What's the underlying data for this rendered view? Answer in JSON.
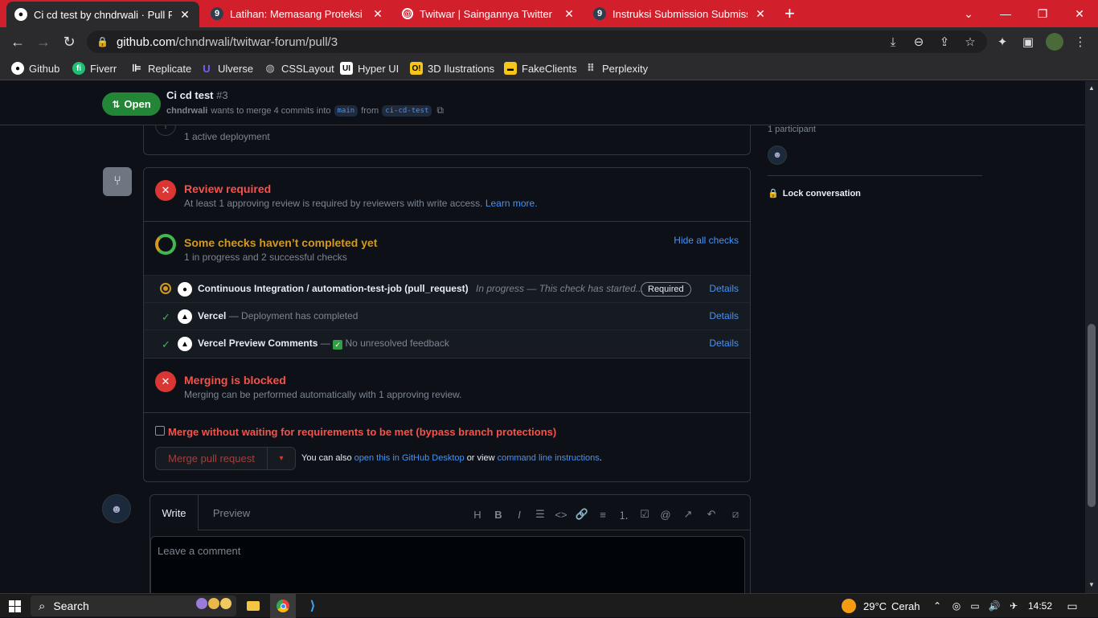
{
  "browser": {
    "tabs": [
      {
        "title": "Ci cd test by chndrwali · Pull Requ",
        "active": true
      },
      {
        "title": "Latihan: Memasang Proteksi pada",
        "active": false
      },
      {
        "title": "Twitwar | Saingannya Twitter",
        "active": false
      },
      {
        "title": "Instruksi Submission Submission",
        "active": false
      }
    ],
    "new_tab_label": "+",
    "url_host": "github.com",
    "url_path": "/chndrwali/twitwar-forum/pull/3",
    "bookmarks": [
      {
        "label": "Github",
        "icon": "github-icon",
        "color": "#ffffff"
      },
      {
        "label": "Fiverr",
        "icon": "fiverr-icon",
        "color": "#1dbf73"
      },
      {
        "label": "Replicate",
        "icon": "replicate-icon",
        "color": "#ffffff"
      },
      {
        "label": "Ulverse",
        "icon": "uiverse-icon",
        "color": "#7c5cff"
      },
      {
        "label": "CSSLayout",
        "icon": "globe-icon",
        "color": "#bbbbbb"
      },
      {
        "label": "Hyper UI",
        "icon": "hyperui-icon",
        "color": "#ffffff"
      },
      {
        "label": "3D Ilustrations",
        "icon": "3d-icon",
        "color": "#f5c518"
      },
      {
        "label": "FakeClients",
        "icon": "fakeclients-icon",
        "color": "#f5c518"
      },
      {
        "label": "Perplexity",
        "icon": "grid-icon",
        "color": "#bbbbbb"
      }
    ]
  },
  "pr": {
    "state": "Open",
    "title": "Ci cd test",
    "number": "#3",
    "author": "chndrwali",
    "merge_text_1": "wants to merge 4 commits into",
    "base_branch": "main",
    "merge_text_2": "from",
    "head_branch": "ci-cd-test"
  },
  "deployment": {
    "status": "1 active deployment"
  },
  "merge_box": {
    "review": {
      "title": "Review required",
      "text": "At least 1 approving review is required by reviewers with write access.",
      "link": "Learn more."
    },
    "checks": {
      "title": "Some checks haven’t completed yet",
      "text": "1 in progress and 2 successful checks",
      "toggle": "Hide all checks",
      "rows": [
        {
          "name": "Continuous Integration / automation-test-job (pull_request)",
          "desc": "In progress — This check has started...",
          "badge": "Required",
          "details": "Details"
        },
        {
          "name": "Vercel",
          "desc": "— Deployment has completed",
          "details": "Details"
        },
        {
          "name": "Vercel Preview Comments",
          "desc_prefix": "—",
          "desc": "No unresolved feedback",
          "details": "Details"
        }
      ]
    },
    "blocked": {
      "title": "Merging is blocked",
      "text": "Merging can be performed automatically with 1 approving review."
    },
    "bypass_label": "Merge without waiting for requirements to be met (bypass branch protections)",
    "merge_button": "Merge pull request",
    "also_text": "You can also",
    "desktop_link": "open this in GitHub Desktop",
    "or_view": "or view",
    "cli_link": "command line instructions",
    "period": "."
  },
  "editor": {
    "write_tab": "Write",
    "preview_tab": "Preview",
    "placeholder": "Leave a comment"
  },
  "sidebar": {
    "participants": "1 participant",
    "lock": "Lock conversation"
  },
  "taskbar": {
    "search": "Search",
    "weather_temp": "29°C",
    "weather_desc": "Cerah",
    "time": "14:52"
  },
  "colors": {
    "tab_bar": "#d1202c",
    "open_green": "#238636",
    "danger_red": "#da3633",
    "warning_orange": "#d29922",
    "link_blue": "#4493f8"
  }
}
